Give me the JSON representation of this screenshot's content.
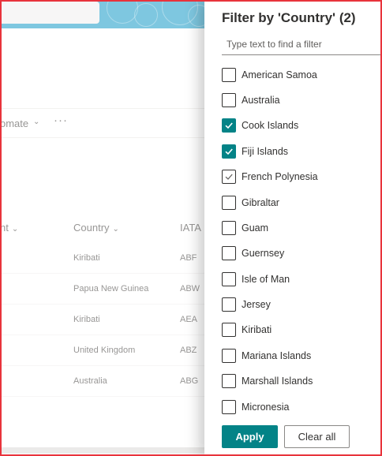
{
  "background": {
    "command_bar": {
      "automate_label": "omate",
      "more_label": "···"
    },
    "columns": {
      "first_label": "nt",
      "country_label": "Country",
      "iata_label": "IATA"
    },
    "rows": [
      {
        "country": "Kiribati",
        "iata": "ABF"
      },
      {
        "country": "Papua New Guinea",
        "iata": "ABW"
      },
      {
        "country": "Kiribati",
        "iata": "AEA"
      },
      {
        "country": "United Kingdom",
        "iata": "ABZ"
      },
      {
        "country": "Australia",
        "iata": "ABG"
      }
    ],
    "colors": {
      "header": "#3aa9cf"
    }
  },
  "filter_pane": {
    "title": "Filter by 'Country' (2)",
    "search_placeholder": "Type text to find a filter",
    "search_value": "",
    "options": [
      {
        "label": "American Samoa",
        "state": "unchecked"
      },
      {
        "label": "Australia",
        "state": "unchecked"
      },
      {
        "label": "Cook Islands",
        "state": "checked"
      },
      {
        "label": "Fiji Islands",
        "state": "checked"
      },
      {
        "label": "French Polynesia",
        "state": "hover"
      },
      {
        "label": "Gibraltar",
        "state": "unchecked"
      },
      {
        "label": "Guam",
        "state": "unchecked"
      },
      {
        "label": "Guernsey",
        "state": "unchecked"
      },
      {
        "label": "Isle of Man",
        "state": "unchecked"
      },
      {
        "label": "Jersey",
        "state": "unchecked"
      },
      {
        "label": "Kiribati",
        "state": "unchecked"
      },
      {
        "label": "Mariana Islands",
        "state": "unchecked"
      },
      {
        "label": "Marshall Islands",
        "state": "unchecked"
      },
      {
        "label": "Micronesia",
        "state": "unchecked"
      }
    ],
    "apply_label": "Apply",
    "clear_label": "Clear all",
    "colors": {
      "accent": "#038387"
    }
  }
}
